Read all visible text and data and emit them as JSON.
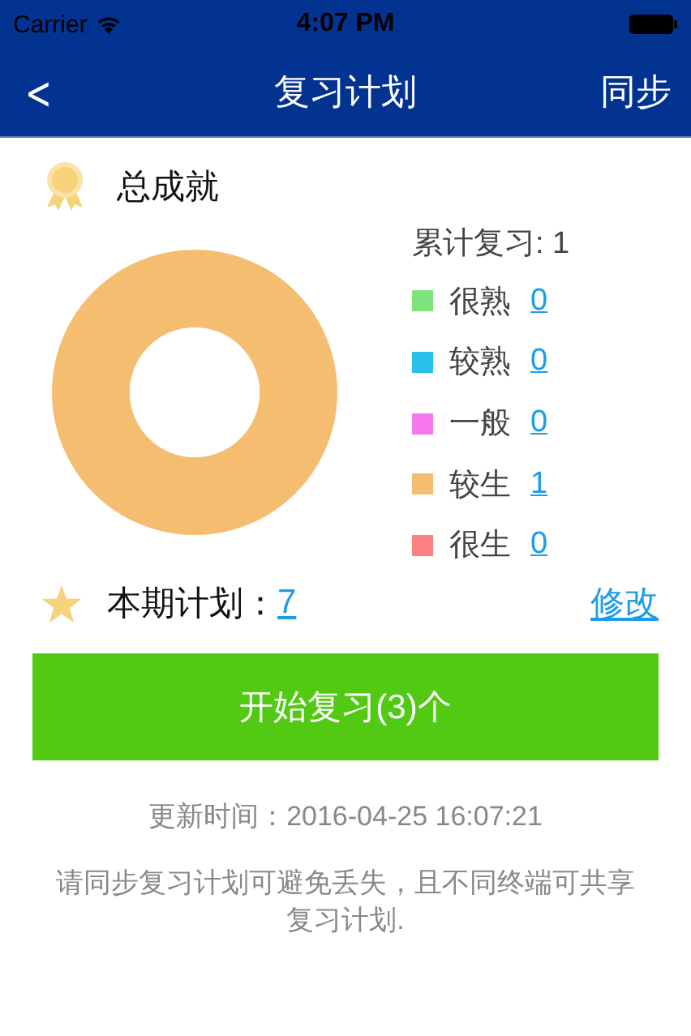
{
  "status_bar": {
    "carrier": "Carrier",
    "time": "4:07 PM"
  },
  "nav_bar": {
    "back": "<",
    "title": "复习计划",
    "action": "同步"
  },
  "achievement": {
    "title": "总成就",
    "total": "累计复习: 1",
    "legend": [
      {
        "count": "0",
        "color": "#7ee37a"
      },
      {
        "count": "0",
        "color": "#29c0ea"
      },
      {
        "count": "0",
        "color": "#f977ec"
      },
      {
        "count": "1",
        "color": "#f5bd6f"
      },
      {
        "count": "0",
        "color": "#fc8080"
      }
    ],
    "chart_data": {
      "type": "donut",
      "categories": [
        "很熟",
        "较熟",
        "一般",
        "较生",
        "很生"
      ],
      "values": [
        0,
        0,
        0,
        1,
        0
      ]
    }
  },
  "plan": {
    "label": "本期计划：",
    "count": "7",
    "edit": "修改"
  },
  "start_button": "开始复习(3)个",
  "update_time": "更新时间：2016-04-25 16:07:21",
  "note": "请同步复习计划可避免丢失，且不同终端可共享复习计划."
}
